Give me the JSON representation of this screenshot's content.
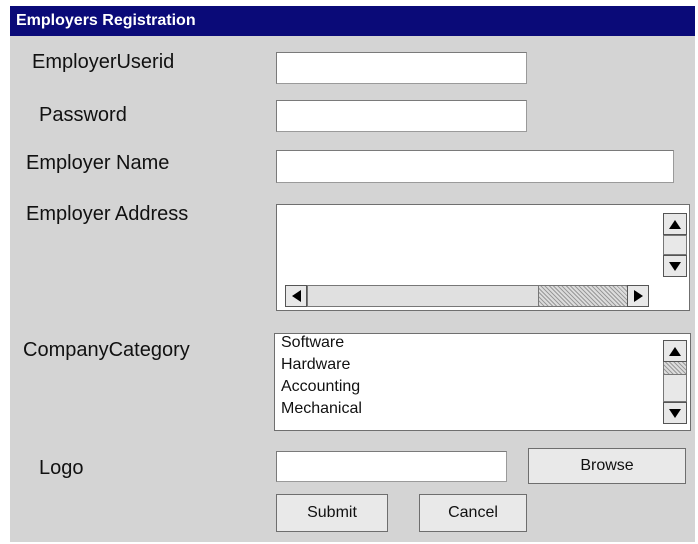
{
  "window": {
    "title": "Employers Registration"
  },
  "fields": {
    "userid": {
      "label": "EmployerUserid",
      "value": ""
    },
    "password": {
      "label": "Password",
      "value": ""
    },
    "name": {
      "label": "Employer Name",
      "value": ""
    },
    "address": {
      "label": "Employer Address",
      "value": ""
    },
    "category": {
      "label": "CompanyCategory",
      "options": [
        "Software",
        "Hardware",
        "Accounting",
        "Mechanical"
      ]
    },
    "logo": {
      "label": "Logo",
      "value": ""
    }
  },
  "buttons": {
    "browse": "Browse",
    "submit": "Submit",
    "cancel": "Cancel"
  },
  "icons": {
    "scroll_up": "triangle-up-icon",
    "scroll_down": "triangle-down-icon",
    "scroll_left": "triangle-left-icon",
    "scroll_right": "triangle-right-icon"
  },
  "colors": {
    "titlebar": "#0a0a78",
    "window_bg": "#d4d4d4",
    "field_bg": "#ffffff"
  }
}
